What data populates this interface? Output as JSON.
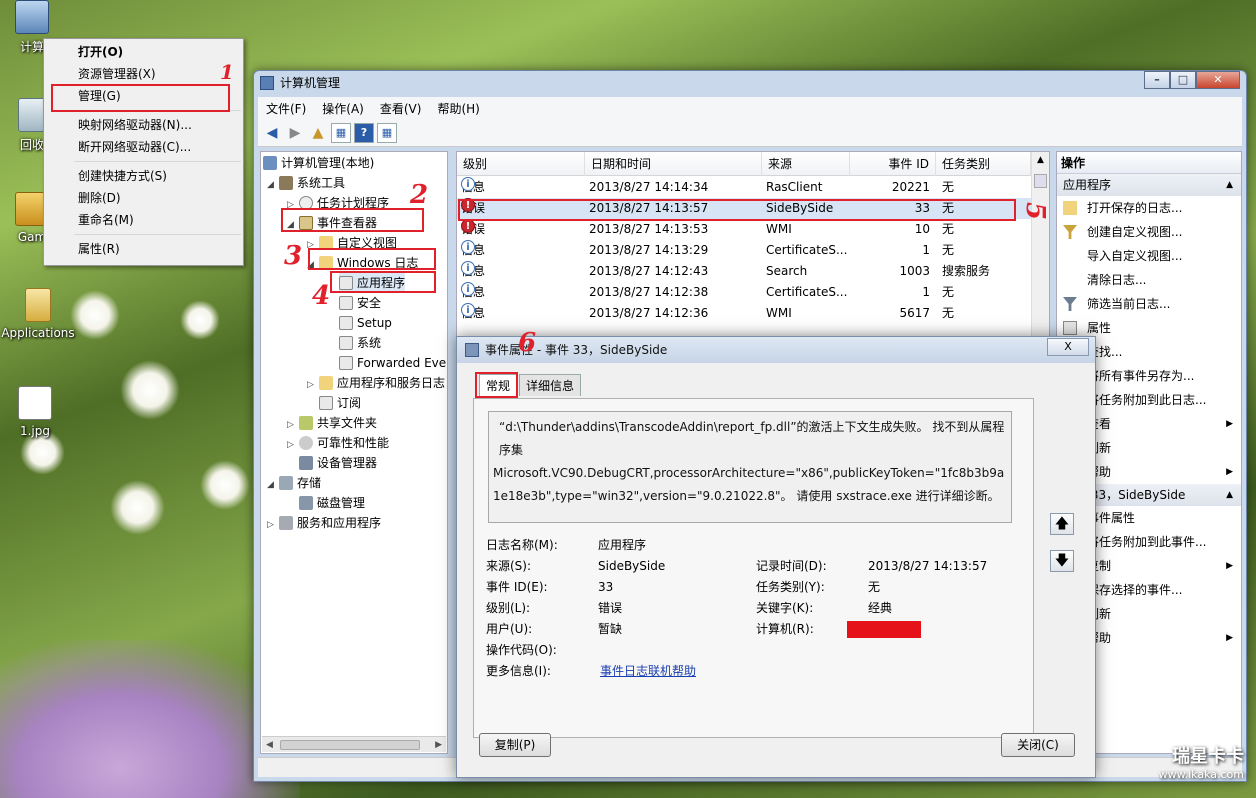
{
  "desktop": {
    "icons": [
      {
        "label": "计算"
      },
      {
        "label": "回收"
      },
      {
        "label": "Gam"
      },
      {
        "label": "Applications"
      },
      {
        "label": "1.jpg"
      }
    ]
  },
  "context_menu": {
    "items": [
      {
        "label": "打开(O)"
      },
      {
        "label": "资源管理器(X)"
      },
      {
        "label": "管理(G)"
      },
      {
        "label": "映射网络驱动器(N)..."
      },
      {
        "label": "断开网络驱动器(C)..."
      },
      {
        "label": "创建快捷方式(S)"
      },
      {
        "label": "删除(D)"
      },
      {
        "label": "重命名(M)"
      },
      {
        "label": "属性(R)"
      }
    ]
  },
  "annotations": {
    "n1": "1",
    "n2": "2",
    "n3": "3",
    "n4": "4",
    "n5": "5",
    "n6": "6",
    "color": "#e0202a"
  },
  "window": {
    "title": "计算机管理",
    "menu": [
      "文件(F)",
      "操作(A)",
      "查看(V)",
      "帮助(H)"
    ],
    "tree": [
      "计算机管理(本地)",
      "系统工具",
      "任务计划程序",
      "事件查看器",
      "自定义视图",
      "Windows 日志",
      "应用程序",
      "安全",
      "Setup",
      "系统",
      "Forwarded Eve",
      "应用程序和服务日志",
      "订阅",
      "共享文件夹",
      "可靠性和性能",
      "设备管理器",
      "存储",
      "磁盘管理",
      "服务和应用程序"
    ],
    "list": {
      "columns": [
        "级别",
        "日期和时间",
        "来源",
        "事件 ID",
        "任务类别"
      ],
      "rows": [
        {
          "level": "信息",
          "date": "2013/8/27 14:14:34",
          "source": "RasClient",
          "id": "20221",
          "category": "无"
        },
        {
          "level": "错误",
          "date": "2013/8/27 14:13:57",
          "source": "SideBySide",
          "id": "33",
          "category": "无"
        },
        {
          "level": "错误",
          "date": "2013/8/27 14:13:53",
          "source": "WMI",
          "id": "10",
          "category": "无"
        },
        {
          "level": "信息",
          "date": "2013/8/27 14:13:29",
          "source": "CertificateS...",
          "id": "1",
          "category": "无"
        },
        {
          "level": "信息",
          "date": "2013/8/27 14:12:43",
          "source": "Search",
          "id": "1003",
          "category": "搜索服务"
        },
        {
          "level": "信息",
          "date": "2013/8/27 14:12:38",
          "source": "CertificateS...",
          "id": "1",
          "category": "无"
        },
        {
          "level": "信息",
          "date": "2013/8/27 14:12:36",
          "source": "WMI",
          "id": "5617",
          "category": "无"
        }
      ]
    },
    "actions": {
      "header": "操作",
      "section1": "应用程序",
      "items1": [
        "打开保存的日志...",
        "创建自定义视图...",
        "导入自定义视图...",
        "清除日志...",
        "筛选当前日志...",
        "属性",
        "查找...",
        "将所有事件另存为...",
        "将任务附加到此日志...",
        "查看",
        "刷新",
        "帮助"
      ],
      "section2": "事件 33，SideBySide",
      "items2": [
        "事件属性",
        "将任务附加到此事件...",
        "复制",
        "保存选择的事件...",
        "刷新",
        "帮助"
      ]
    }
  },
  "dialog": {
    "title": "事件属性 - 事件 33，SideBySide",
    "close": "X",
    "tabs": [
      "常规",
      "详细信息"
    ],
    "message": [
      "“d:\\Thunder\\addins\\TranscodeAddin\\report_fp.dll”的激活上下文生成失败。 找不到从属程序集",
      "Microsoft.VC90.DebugCRT,processorArchitecture=\"x86\",publicKeyToken=\"1fc8b3b9a1e18e3b\",type=\"win32\",version=\"9.0.21022.8\"。 请使用 sxstrace.exe 进行详细诊断。"
    ],
    "fields": {
      "log_name_label": "日志名称(M):",
      "log_name": "应用程序",
      "source_label": "来源(S):",
      "source": "SideBySide",
      "logged_label": "记录时间(D):",
      "logged": "2013/8/27 14:13:57",
      "event_id_label": "事件 ID(E):",
      "event_id": "33",
      "task_label": "任务类别(Y):",
      "task": "无",
      "level_label": "级别(L):",
      "level": "错误",
      "keywords_label": "关键字(K):",
      "keywords": "经典",
      "user_label": "用户(U):",
      "user": "暂缺",
      "computer_label": "计算机(R):",
      "opcode_label": "操作代码(O):",
      "more_info_label": "更多信息(I):",
      "more_info_link": "事件日志联机帮助"
    },
    "copy_button": "复制(P)",
    "close_button": "关闭(C)"
  },
  "watermark": {
    "line1": "瑞星卡卡",
    "line2": "www.ikaka.com"
  }
}
